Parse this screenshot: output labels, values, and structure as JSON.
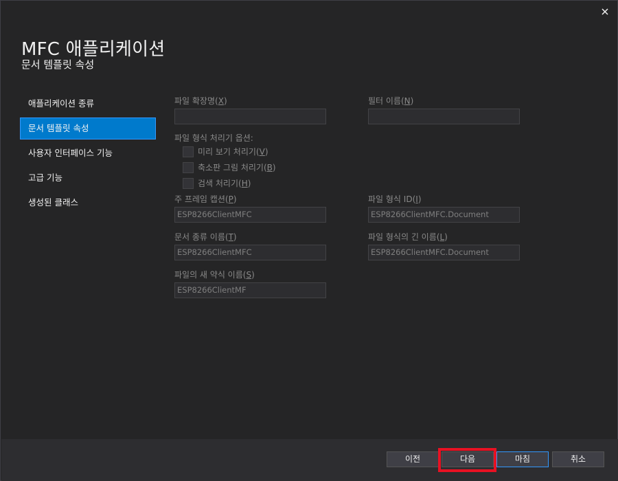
{
  "window": {
    "title": "MFC 애플리케이션",
    "subtitle": "문서 템플릿 속성",
    "close_glyph": "✕"
  },
  "nav": {
    "items": [
      {
        "label": "애플리케이션 종류",
        "active": false
      },
      {
        "label": "문서 템플릿 속성",
        "active": true
      },
      {
        "label": "사용자 인터페이스 기능",
        "active": false
      },
      {
        "label": "고급 기능",
        "active": false
      },
      {
        "label": "생성된 클래스",
        "active": false
      }
    ]
  },
  "form": {
    "file_ext": {
      "label": "파일 확장명",
      "key": "X",
      "value": ""
    },
    "filter_name": {
      "label": "필터 이름",
      "key": "N",
      "value": ""
    },
    "file_type_options": {
      "label": "파일 형식 처리기 옵션:"
    },
    "preview_handler": {
      "label": "미리 보기 처리기",
      "key": "V",
      "checked": false
    },
    "thumbnail_handler": {
      "label": "축소판 그림 처리기",
      "key": "B",
      "checked": false
    },
    "search_handler": {
      "label": "검색 처리기",
      "key": "H",
      "checked": false
    },
    "main_frame_caption": {
      "label": "주 프레임 캡션",
      "key": "P",
      "value": "ESP8266ClientMFC"
    },
    "file_type_id": {
      "label": "파일 형식 ID",
      "key": "I",
      "value": "ESP8266ClientMFC.Document"
    },
    "doc_type_name": {
      "label": "문서 종류 이름",
      "key": "T",
      "value": "ESP8266ClientMFC"
    },
    "file_type_long_name": {
      "label": "파일 형식의 긴 이름",
      "key": "L",
      "value": "ESP8266ClientMFC.Document"
    },
    "file_new_short_name": {
      "label": "파일의 새 약식 이름",
      "key": "S",
      "value": "ESP8266ClientMF"
    }
  },
  "footer": {
    "prev_label": "이전",
    "next_label": "다음",
    "finish_label": "마침",
    "cancel_label": "취소"
  },
  "colors": {
    "background": "#252526",
    "accent": "#007acc",
    "highlight": "#e81123"
  }
}
